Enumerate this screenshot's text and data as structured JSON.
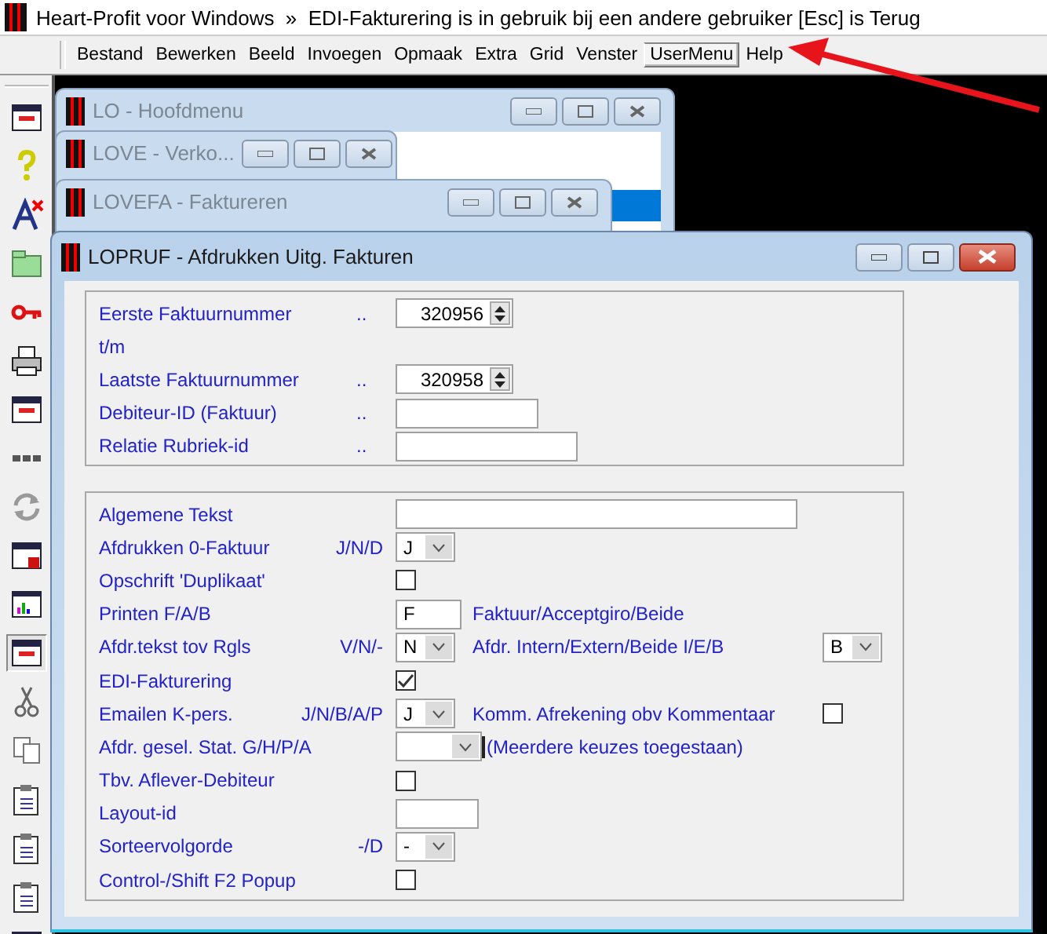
{
  "app_title": "Heart-Profit voor Windows  »  EDI-Fakturering is in gebruik bij een andere gebruiker [Esc] is Terug",
  "menu": [
    {
      "label": "Bestand",
      "selected": false
    },
    {
      "label": "Bewerken",
      "selected": false
    },
    {
      "label": "Beeld",
      "selected": false
    },
    {
      "label": "Invoegen",
      "selected": false
    },
    {
      "label": "Opmaak",
      "selected": false
    },
    {
      "label": "Extra",
      "selected": false
    },
    {
      "label": "Grid",
      "selected": false
    },
    {
      "label": "Venster",
      "selected": false
    },
    {
      "label": "UserMenu",
      "selected": true
    },
    {
      "label": "Help",
      "selected": false
    }
  ],
  "windows": [
    {
      "title": "LO - Hoofdmenu"
    },
    {
      "title": "LOVE - Verko..."
    },
    {
      "title": "LOVEFA - Faktureren"
    }
  ],
  "dialog": {
    "title": "LOPRUF - Afdrukken Uitg. Fakturen",
    "selection": [
      {
        "label": "Eerste  Faktuurnummer",
        "dots": "..",
        "kind": "spin",
        "value": "320956"
      },
      {
        "label": "t/m",
        "kind": "none"
      },
      {
        "label": "Laatste Faktuurnummer",
        "dots": "..",
        "kind": "spin",
        "value": "320958"
      },
      {
        "label": "Debiteur-ID (Faktuur)",
        "dots": "..",
        "kind": "text"
      },
      {
        "label": "Relatie Rubriek-id",
        "dots": "..",
        "kind": "text"
      }
    ],
    "options": [
      {
        "label": "Algemene Tekst",
        "kind": "text"
      },
      {
        "label": "Afdrukken 0-Faktuur",
        "hint": "J/N/D",
        "kind": "select",
        "value": "J"
      },
      {
        "label": "Opschrift 'Duplikaat'",
        "kind": "check",
        "checked": false
      },
      {
        "label": "Printen F/A/B",
        "kind": "text",
        "value": "F",
        "extra_label": "Faktuur/Acceptgiro/Beide"
      },
      {
        "label": "Afdr.tekst tov Rgls",
        "hint": "V/N/-",
        "kind": "select",
        "value": "N",
        "extra_label": "Afdr. Intern/Extern/Beide I/E/B",
        "extra": {
          "kind": "select",
          "value": "B"
        }
      },
      {
        "label": "EDI-Fakturering",
        "kind": "check",
        "checked": true
      },
      {
        "label": "Emailen K-pers.",
        "hint": "J/N/B/A/P",
        "kind": "select",
        "value": "J",
        "extra_label": "Komm. Afrekening obv Kommentaar",
        "extra": {
          "kind": "check",
          "checked": false
        }
      },
      {
        "label": "Afdr. gesel. Stat. G/H/P/A",
        "kind": "select",
        "extra_label": "(Meerdere keuzes toegestaan)"
      },
      {
        "label": "Tbv. Aflever-Debiteur",
        "kind": "check",
        "checked": false
      },
      {
        "label": "Layout-id",
        "kind": "text"
      },
      {
        "label": "Sorteervolgorde",
        "hint": "-/D",
        "kind": "select",
        "value": "-"
      },
      {
        "label": "Control-/Shift F2 Popup",
        "kind": "check",
        "checked": false
      }
    ]
  }
}
